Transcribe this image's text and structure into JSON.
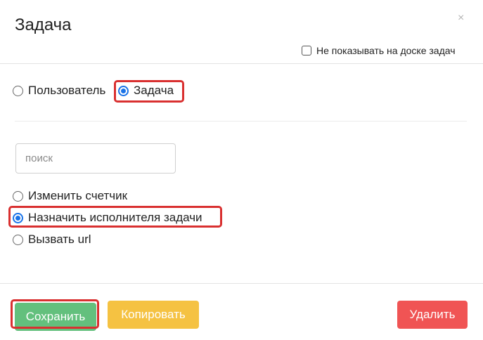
{
  "dialog": {
    "title": "Задача",
    "close_symbol": "×",
    "hide_on_board_label": "Не показывать на доске задач",
    "hide_on_board_checked": false
  },
  "target_type": {
    "options": [
      {
        "label": "Пользователь",
        "selected": false
      },
      {
        "label": "Задача",
        "selected": true
      }
    ]
  },
  "search": {
    "placeholder": "поиск",
    "value": ""
  },
  "actions": {
    "options": [
      {
        "label": "Изменить счетчик",
        "selected": false
      },
      {
        "label": "Назначить исполнителя задачи",
        "selected": true
      },
      {
        "label": "Вызвать url",
        "selected": false
      }
    ]
  },
  "footer": {
    "save_label": "Сохранить",
    "copy_label": "Копировать",
    "delete_label": "Удалить"
  },
  "colors": {
    "save": "#63c07d",
    "copy": "#f5c242",
    "delete": "#f05454",
    "highlight": "#d93030",
    "radio_accent": "#1a73e8"
  }
}
